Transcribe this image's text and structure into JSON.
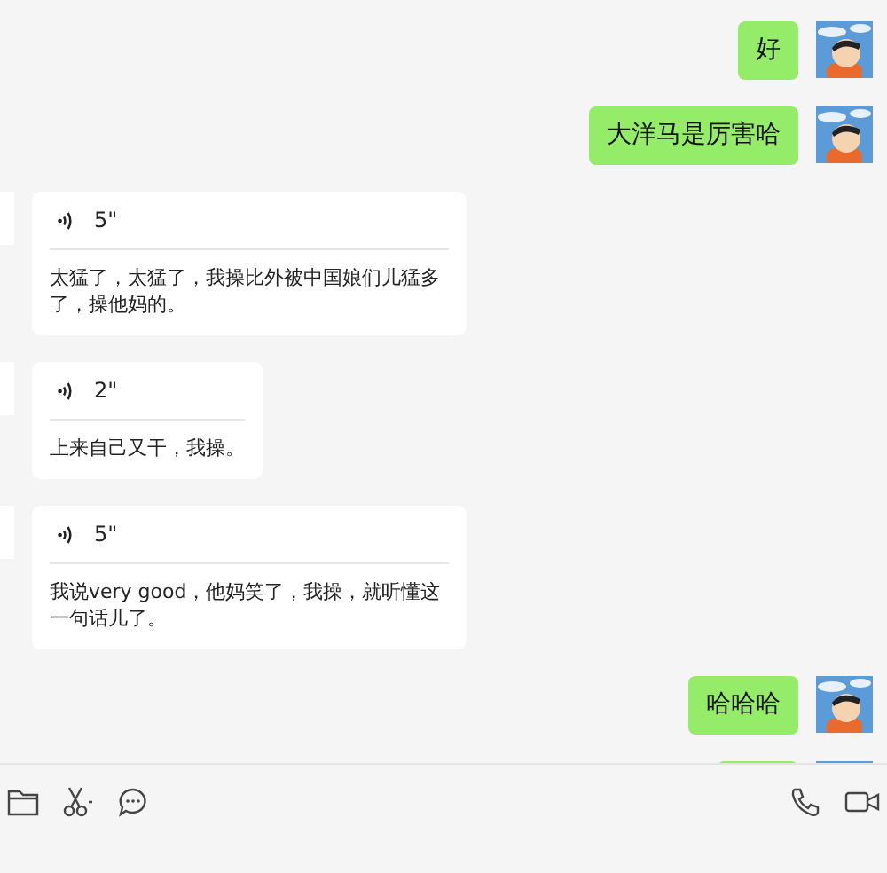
{
  "messages": [
    {
      "kind": "sent",
      "text": "好"
    },
    {
      "kind": "sent",
      "text": "大洋马是厉害哈"
    },
    {
      "kind": "voice",
      "duration": "5\"",
      "transcript": "太猛了，太猛了，我操比外被中国娘们儿猛多了，操他妈的。"
    },
    {
      "kind": "voice",
      "duration": "2\"",
      "transcript": "上来自己又干，我操。"
    },
    {
      "kind": "voice",
      "duration": "5\"",
      "transcript": "我说very good，他妈笑了，我操，就听懂这一句话儿了。"
    },
    {
      "kind": "sent",
      "text": "哈哈哈"
    },
    {
      "kind": "sent_partial"
    }
  ]
}
